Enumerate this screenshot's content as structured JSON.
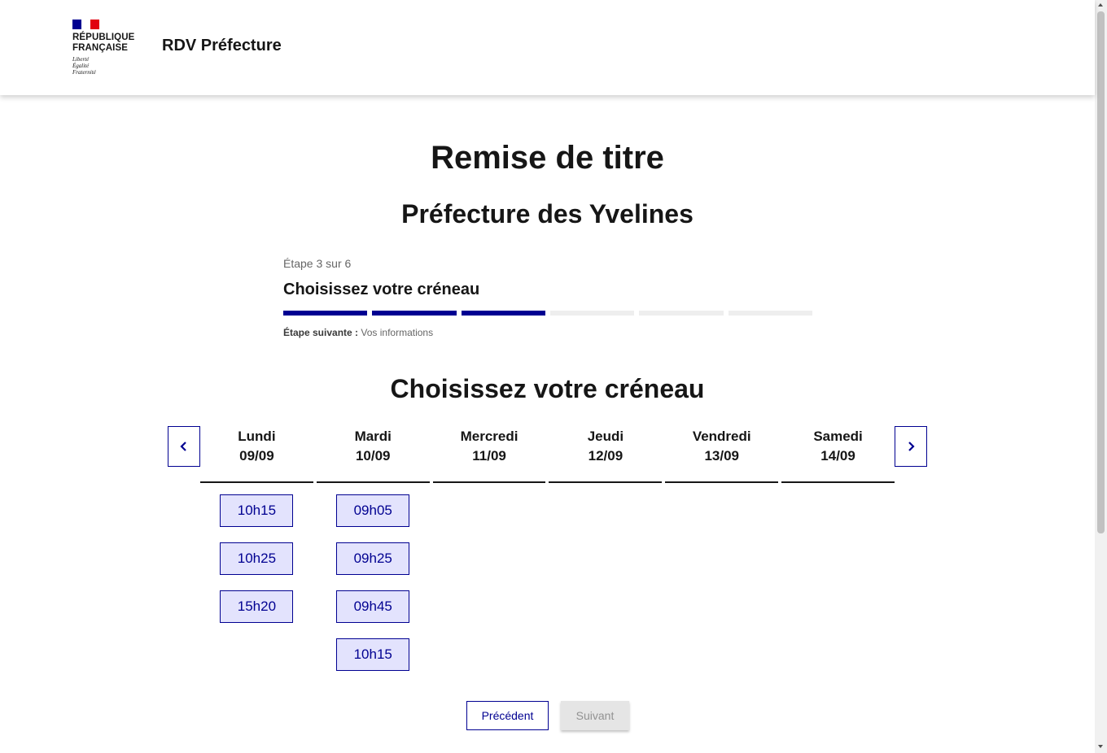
{
  "header": {
    "logo_line1": "RÉPUBLIQUE",
    "logo_line2": "FRANÇAISE",
    "devise1": "Liberté",
    "devise2": "Égalité",
    "devise3": "Fraternité",
    "site_title": "RDV Préfecture"
  },
  "page": {
    "title": "Remise de titre",
    "subtitle": "Préfecture des Yvelines"
  },
  "stepper": {
    "state": "Étape 3 sur 6",
    "title": "Choisissez votre créneau",
    "current_step": 3,
    "total_steps": 6,
    "next_label": "Étape suivante :",
    "next_value": "Vos informations"
  },
  "calendar": {
    "title": "Choisissez votre créneau",
    "prev_icon": "chevron-left-icon",
    "next_icon": "chevron-right-icon",
    "days": [
      {
        "name": "Lundi",
        "date": "09/09",
        "slots": [
          "10h15",
          "10h25",
          "15h20"
        ]
      },
      {
        "name": "Mardi",
        "date": "10/09",
        "slots": [
          "09h05",
          "09h25",
          "09h45",
          "10h15"
        ]
      },
      {
        "name": "Mercredi",
        "date": "11/09",
        "slots": []
      },
      {
        "name": "Jeudi",
        "date": "12/09",
        "slots": []
      },
      {
        "name": "Vendredi",
        "date": "13/09",
        "slots": []
      },
      {
        "name": "Samedi",
        "date": "14/09",
        "slots": []
      }
    ]
  },
  "buttons": {
    "previous": "Précédent",
    "next": "Suivant"
  },
  "colors": {
    "primary": "#000091",
    "slot_bg": "#e3e3fd",
    "flag_red": "#e1000f",
    "disabled_bg": "#e5e5e5",
    "disabled_text": "#929292"
  }
}
